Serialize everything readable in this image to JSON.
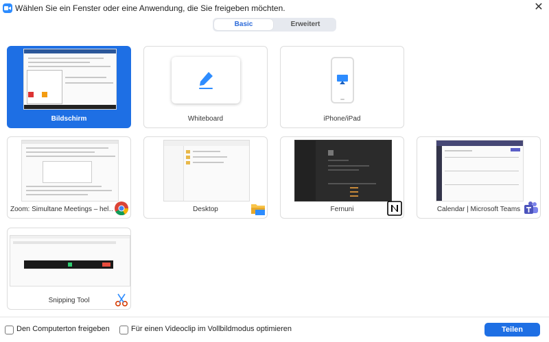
{
  "window": {
    "title": "Wählen Sie ein Fenster oder eine Anwendung, die Sie freigeben möchten.",
    "app_icon": "zoom-camera-icon",
    "close_icon": "close-icon",
    "close_glyph": "✕"
  },
  "tabs": {
    "basic_label": "Basic",
    "advanced_label": "Erweitert",
    "active": "Basic"
  },
  "cards": [
    {
      "label": "Bildschirm",
      "selected": true
    },
    {
      "label": "Whiteboard"
    },
    {
      "label": "iPhone/iPad"
    },
    {
      "label": "Zoom: Simultane Meetings – hel…",
      "badge": "chrome-icon"
    },
    {
      "label": "Desktop",
      "badge": "file-explorer-icon"
    },
    {
      "label": "Fernuni",
      "badge": "notion-icon"
    },
    {
      "label": "Calendar | Microsoft Teams",
      "badge": "teams-icon"
    },
    {
      "label": "Snipping Tool",
      "badge": "snipping-tool-icon"
    }
  ],
  "footer": {
    "computer_audio_label": "Den Computerton freigeben",
    "computer_audio_checked": false,
    "video_optimize_label": "Für einen Videoclip im Vollbildmodus optimieren",
    "video_optimize_checked": false,
    "share_button_label": "Teilen"
  },
  "colors": {
    "accent": "#1e6fe4",
    "zoom_blue": "#2d8cff",
    "teams_purple": "#5b5fc7"
  }
}
